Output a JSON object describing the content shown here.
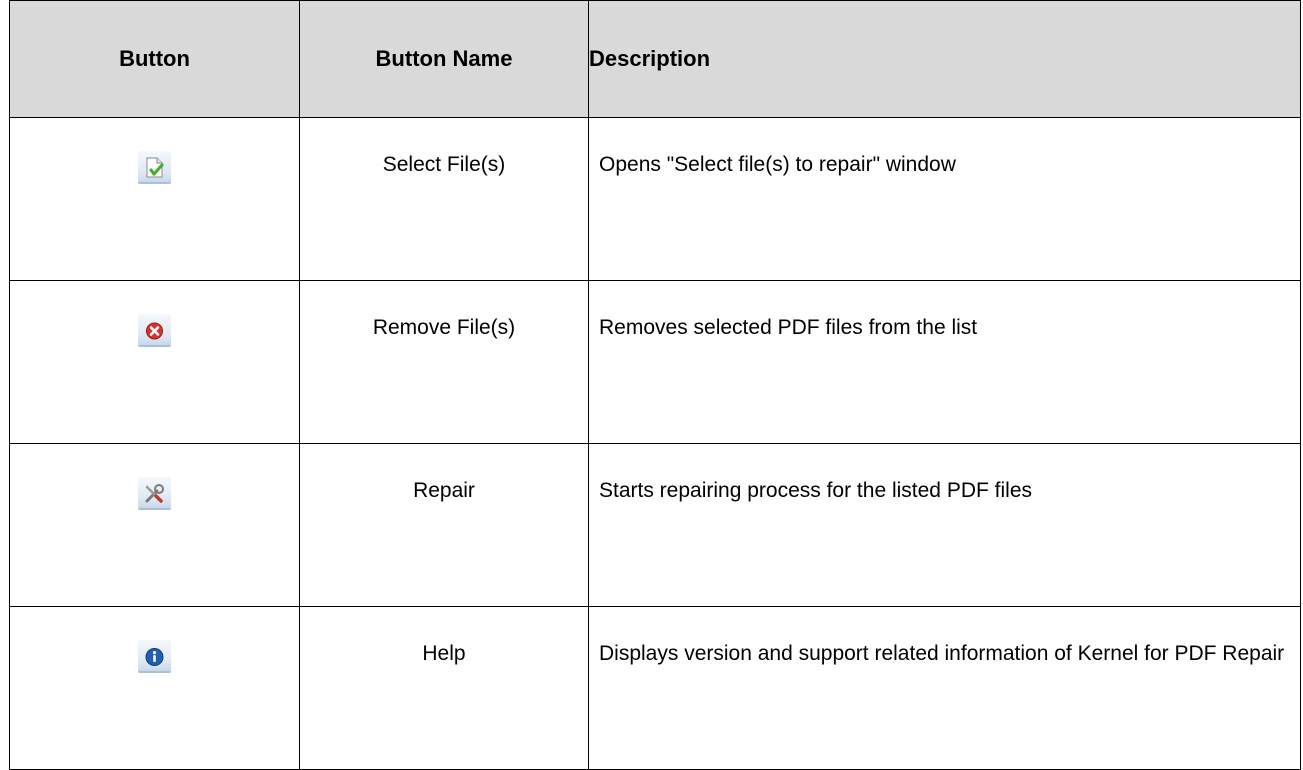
{
  "table": {
    "headers": {
      "button": "Button",
      "button_name": "Button Name",
      "description": "Description"
    },
    "rows": [
      {
        "icon": "select-files-icon",
        "name": "Select File(s)",
        "description": "Opens \"Select file(s) to repair\" window"
      },
      {
        "icon": "remove-files-icon",
        "name": "Remove File(s)",
        "description": "Removes selected PDF files from the list"
      },
      {
        "icon": "repair-tools-icon",
        "name": "Repair",
        "description": "Starts repairing process for the listed PDF files"
      },
      {
        "icon": "help-info-icon",
        "name": "Help",
        "description": "Displays version and support related information of Kernel for PDF Repair"
      }
    ]
  },
  "colors": {
    "header_background": "#d9d9d9",
    "border": "#000000",
    "remove_icon_red": "#d8322c",
    "check_green": "#3fae2a",
    "info_blue": "#1d5fb8"
  }
}
